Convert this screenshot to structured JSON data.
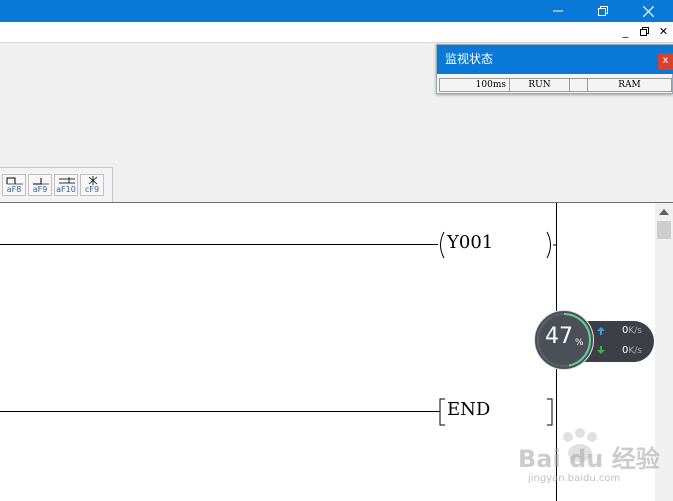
{
  "monitor_window": {
    "title": "监视状态",
    "close_label": "x",
    "status": {
      "scan_time": "100ms",
      "run_state": "RUN",
      "empty": "",
      "memory": "RAM"
    }
  },
  "mdi_controls": {
    "minimize": "_",
    "restore": "🗗",
    "close": "✕"
  },
  "toolbar_buttons": [
    {
      "key": "aF8"
    },
    {
      "key": "aF9"
    },
    {
      "key": "aF10"
    },
    {
      "key": "cF9"
    }
  ],
  "ladder": {
    "coil_label": "Y001",
    "end_label": "END"
  },
  "network_widget": {
    "percent": "47",
    "percent_sign": "%",
    "upload_value": "0",
    "upload_unit": "K/s",
    "download_value": "0",
    "download_unit": "K/s",
    "load_fraction": 0.47
  },
  "watermark": {
    "text": "Bai du 经验",
    "url": "jingyan.baidu.com"
  },
  "colors": {
    "title_bar": "#0a78d7",
    "close_red": "#d9412f",
    "upload_arrow": "#3aa0e8",
    "download_arrow": "#39b54a"
  }
}
